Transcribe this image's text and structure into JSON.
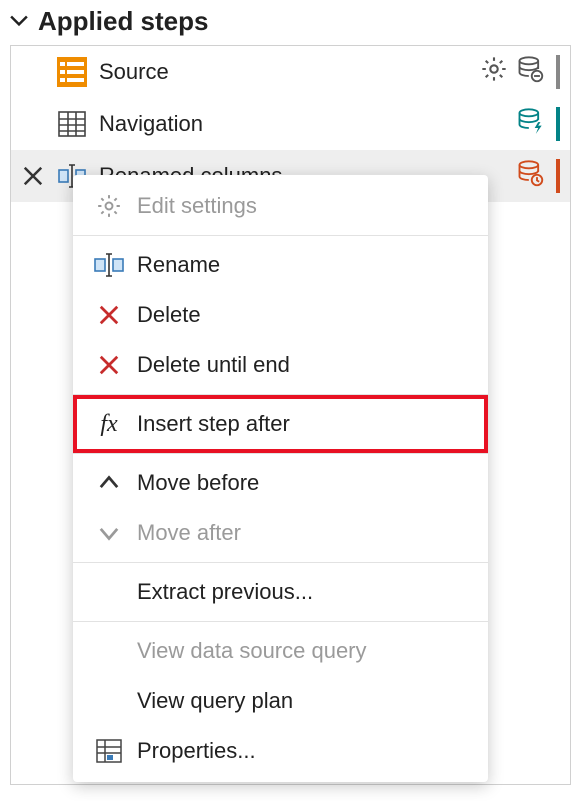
{
  "panel": {
    "title": "Applied steps"
  },
  "steps": [
    {
      "label": "Source"
    },
    {
      "label": "Navigation"
    },
    {
      "label": "Renamed columns"
    }
  ],
  "menu": {
    "edit_settings": "Edit settings",
    "rename": "Rename",
    "delete": "Delete",
    "delete_until_end": "Delete until end",
    "insert_step_after": "Insert step after",
    "move_before": "Move before",
    "move_after": "Move after",
    "extract_previous": "Extract previous...",
    "view_data_source_query": "View data source query",
    "view_query_plan": "View query plan",
    "properties": "Properties..."
  }
}
